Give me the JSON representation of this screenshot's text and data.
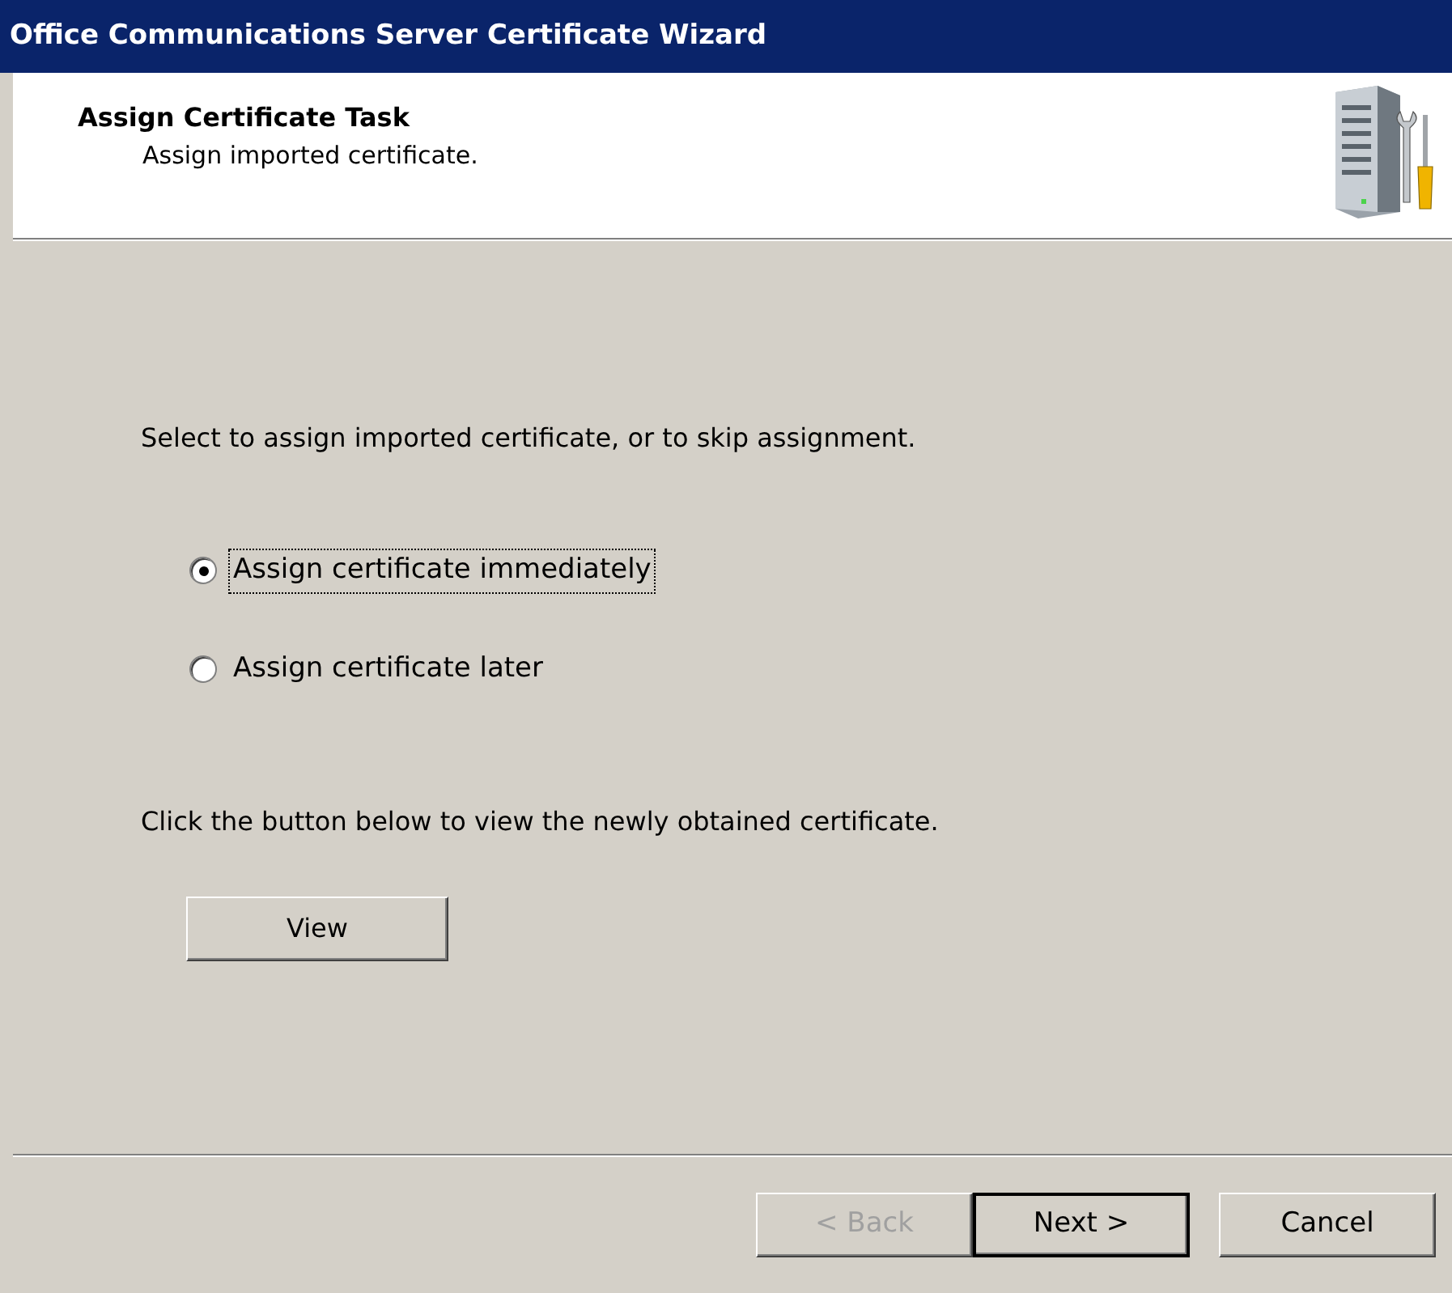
{
  "window": {
    "title": "Office Communications Server Certificate Wizard"
  },
  "header": {
    "title": "Assign Certificate Task",
    "subtitle": "Assign imported certificate."
  },
  "instruction": "Select to assign imported certificate, or to skip assignment.",
  "options": [
    {
      "label": "Assign certificate immediately",
      "selected": true,
      "focused": true
    },
    {
      "label": "Assign certificate later",
      "selected": false,
      "focused": false
    }
  ],
  "view_note": "Click the button below to view the newly obtained certificate.",
  "view_button": {
    "label": "View"
  },
  "buttons": [
    {
      "label": "< Back",
      "disabled": true,
      "default": false
    },
    {
      "label": "Next >",
      "disabled": false,
      "default": true
    },
    {
      "label": "Cancel",
      "disabled": false,
      "default": false
    }
  ]
}
